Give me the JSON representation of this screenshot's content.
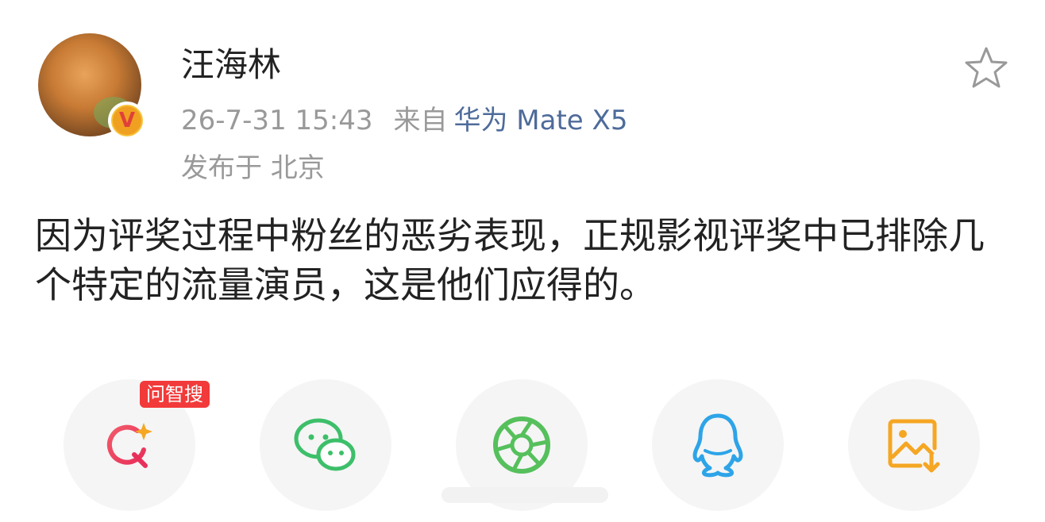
{
  "post": {
    "author": "汪海林",
    "timestamp": "26-7-31 15:43",
    "source_prefix": "来自",
    "device": "华为 Mate X5",
    "location": "发布于 北京",
    "text": "因为评奖过程中粉丝的恶劣表现，正规影视评奖中已排除几个特定的流量演员，这是他们应得的。"
  },
  "badge": {
    "verified_letter": "V"
  },
  "share": {
    "tag": "问智搜",
    "items": [
      {
        "icon": "ai-search-icon",
        "color": "#e8475c"
      },
      {
        "icon": "wechat-icon",
        "color": "#3dbf6a"
      },
      {
        "icon": "moments-icon",
        "color": "#56c05c"
      },
      {
        "icon": "qq-icon",
        "color": "#2ea4e8"
      },
      {
        "icon": "save-image-icon",
        "color": "#f5a623"
      }
    ]
  },
  "colors": {
    "name": "#222222",
    "meta": "#999999",
    "device_link": "#4e6b9a",
    "tag_bg": "#f23a3a",
    "button_bg": "#f5f5f5"
  }
}
